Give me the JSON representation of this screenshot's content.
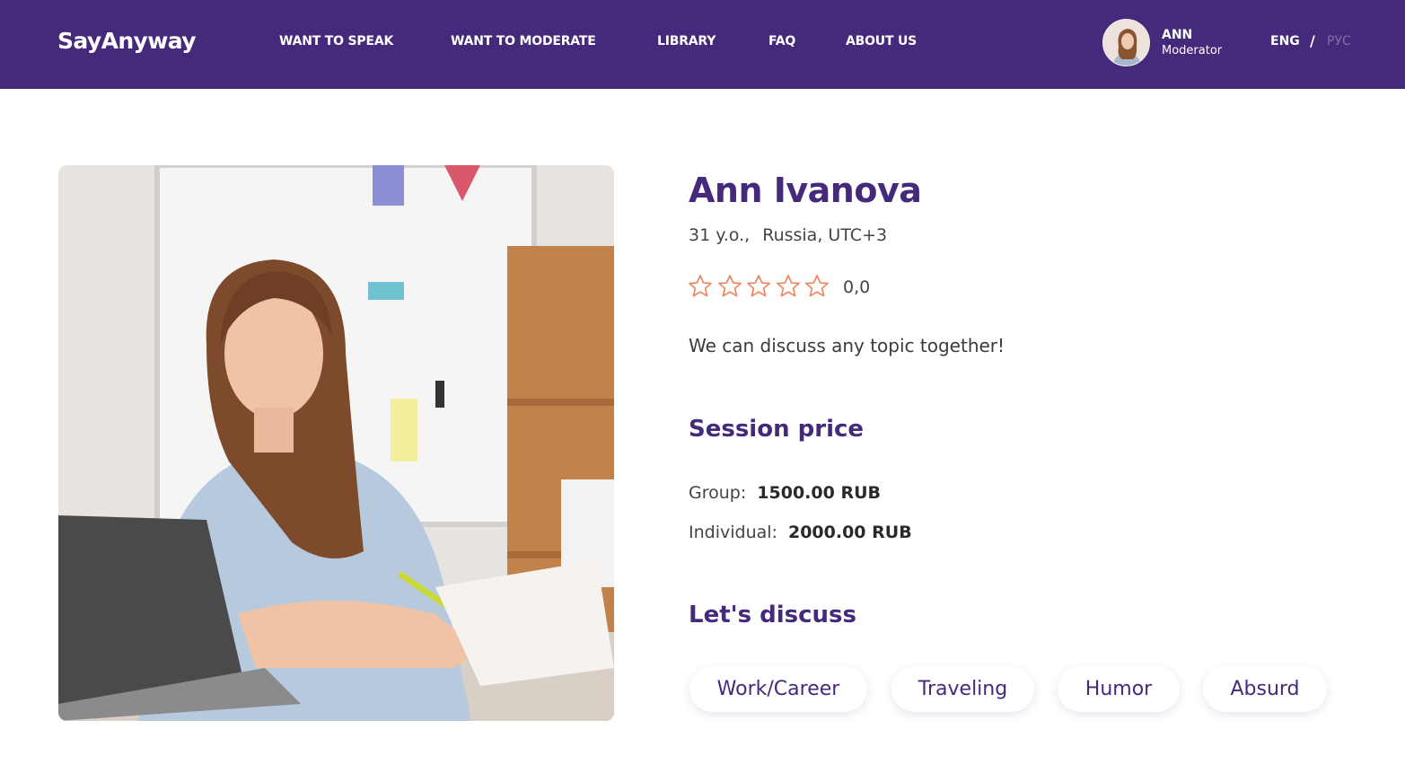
{
  "header": {
    "logo": "SayAnyway",
    "nav": [
      {
        "label": "WANT TO SPEAK"
      },
      {
        "label": "WANT TO MODERATE"
      },
      {
        "label": "LIBRARY"
      },
      {
        "label": "FAQ"
      },
      {
        "label": "ABOUT US"
      }
    ],
    "user": {
      "name": "ANN",
      "role": "Moderator"
    },
    "languages": {
      "active": "ENG",
      "separator": "/",
      "inactive": "РУС"
    }
  },
  "profile": {
    "name": "Ann Ivanova",
    "age": "31 y.o.,",
    "location": "Russia, UTC+3",
    "rating": {
      "stars_filled": 0,
      "stars_total": 5,
      "value": "0,0"
    },
    "bio": "We can discuss any topic together!"
  },
  "session_price": {
    "title": "Session price",
    "group_label": "Group:",
    "group_value": "1500.00 RUB",
    "individual_label": "Individual:",
    "individual_value": "2000.00 RUB"
  },
  "discuss": {
    "title": "Let's discuss",
    "tags": [
      "Work/Career",
      "Traveling",
      "Humor",
      "Absurd"
    ]
  },
  "colors": {
    "brand": "#45297a",
    "star_outline": "#f0825a"
  }
}
